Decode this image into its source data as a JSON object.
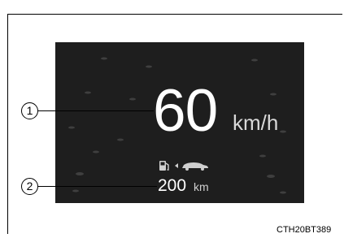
{
  "display": {
    "speed_value": "60",
    "speed_unit": "km/h",
    "range_value": "200",
    "range_unit": "km"
  },
  "callouts": [
    "1",
    "2"
  ],
  "caption": "CTH20BT389",
  "colors": {
    "screen_bg": "#1e1e1e",
    "text_primary": "#ffffff"
  },
  "icons": [
    "fuel-pump-icon",
    "arrow-left-icon",
    "car-icon"
  ]
}
